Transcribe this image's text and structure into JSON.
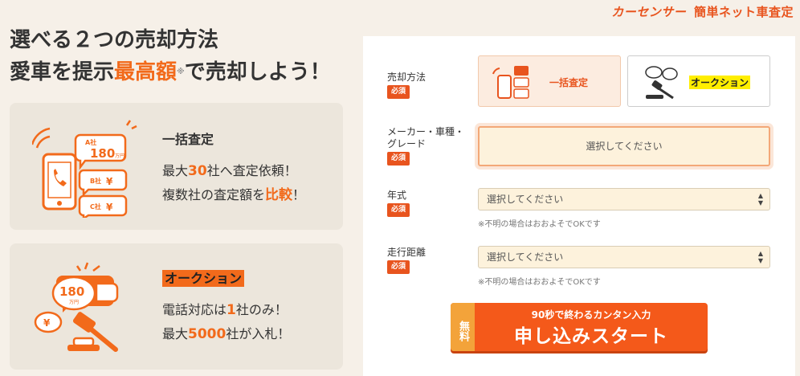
{
  "brand": {
    "logo": "カーセンサー",
    "service": "簡単ネット車査定"
  },
  "headline": {
    "line1": "選べる２つの売却方法",
    "line2_pre": "愛車を提示",
    "line2_accent": "最高額",
    "line2_note": "※",
    "line2_post": "で売却しよう！"
  },
  "card_bulk": {
    "title": "一括査定",
    "line1_pre": "最大",
    "line1_num": "30",
    "line1_post": "社へ査定依頼！",
    "line2_pre": "複数社の査定額を",
    "line2_strong": "比較",
    "line2_post": "！",
    "bubble_a_company": "A社",
    "bubble_a_price": "180",
    "bubble_a_unit": "万円",
    "bubble_b_company": "B社",
    "bubble_c_company": "C社",
    "yen": "¥"
  },
  "card_auction": {
    "title": "オークション",
    "line1_pre": "電話対応は",
    "line1_num": "1",
    "line1_post": "社のみ！",
    "line2_pre": "最大",
    "line2_num": "5000",
    "line2_post": "社が入札！",
    "bubble_price": "180",
    "bubble_unit": "万円",
    "yen": "¥"
  },
  "form": {
    "method_label": "売却方法",
    "required": "必須",
    "method_bulk": "一括査定",
    "method_auction": "オークション",
    "vehicle_label_1": "メーカー・車種・",
    "vehicle_label_2": "グレード",
    "vehicle_placeholder": "選択してください",
    "year_label": "年式",
    "year_value": "選択してください",
    "year_hint": "※不明の場合はおおよそでOKです",
    "mileage_label": "走行距離",
    "mileage_value": "選択してください",
    "mileage_hint": "※不明の場合はおおよそでOKです"
  },
  "submit": {
    "free": "無料",
    "sub": "90秒で終わるカンタン入力",
    "main": "申し込みスタート"
  },
  "colors": {
    "accent": "#f26a1b",
    "button": "#f4591a",
    "field_bg": "#fdf2dc"
  }
}
